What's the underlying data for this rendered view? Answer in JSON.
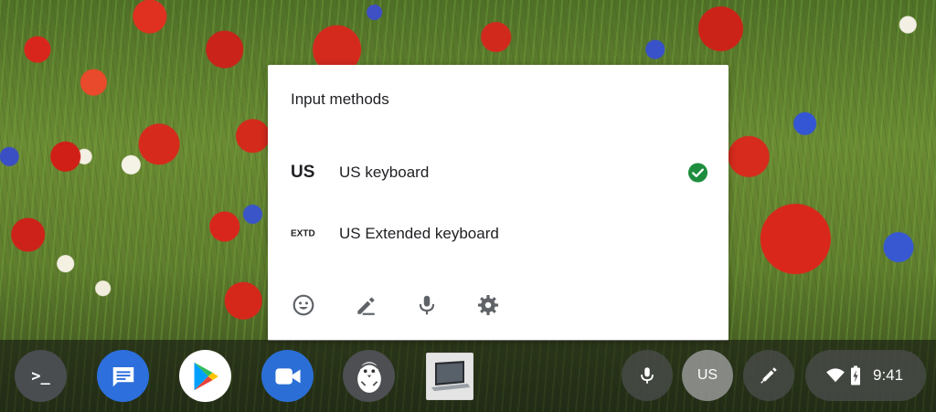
{
  "panel": {
    "title": "Input methods",
    "methods": [
      {
        "short": "US",
        "name": "US keyboard",
        "selected": true
      },
      {
        "short": "EXTD",
        "name": "US Extended keyboard",
        "selected": false
      }
    ],
    "tools": [
      "emoji-icon",
      "handwriting-icon",
      "voice-input-icon",
      "settings-icon"
    ]
  },
  "shelf": {
    "apps": [
      "terminal",
      "messages",
      "play-store",
      "duo",
      "penguin",
      "screenshot-thumbnail"
    ],
    "terminal_glyph": ">_",
    "ime_indicator": "US",
    "time": "9:41"
  },
  "colors": {
    "check": "#1e8e3e",
    "icon_gray": "#5f6368",
    "messages_blue": "#2d6fdc",
    "duo_blue": "#2b6fd6"
  }
}
